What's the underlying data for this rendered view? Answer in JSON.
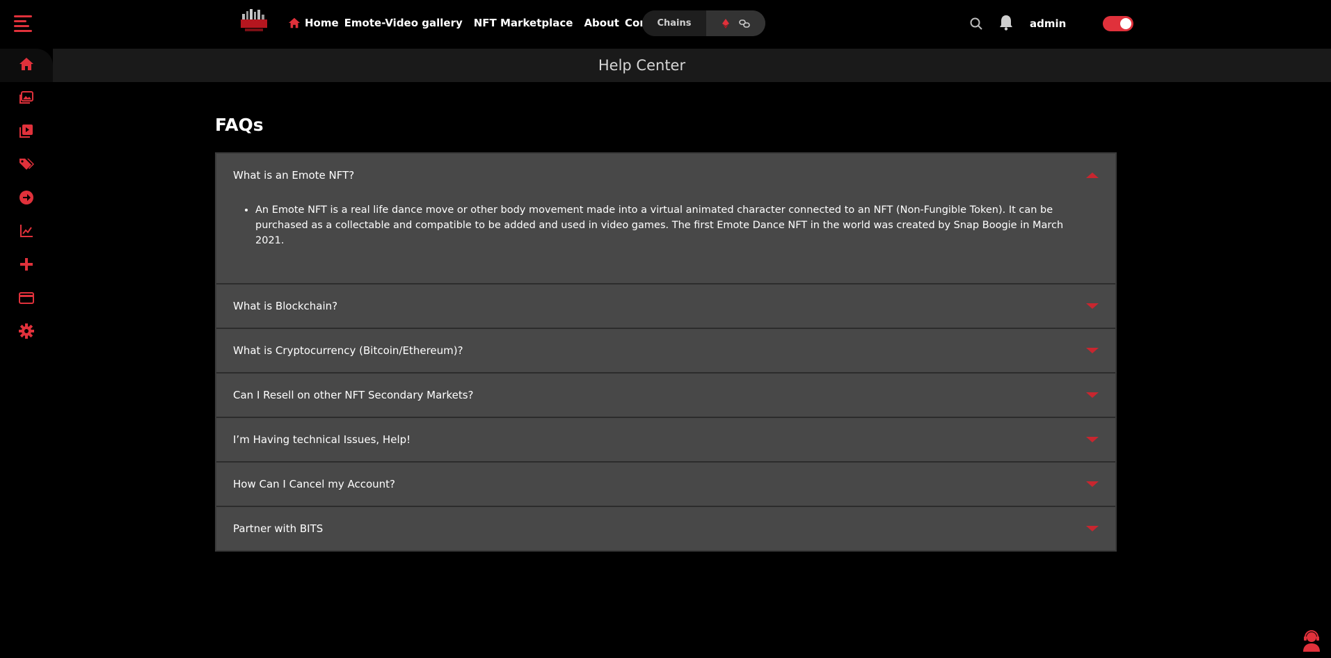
{
  "colors": {
    "accent": "#e0313b",
    "background": "#000000",
    "panel": "#484848"
  },
  "nav": {
    "items": [
      "Home",
      "Emote-Video gallery",
      "NFT Marketplace",
      "About",
      "Contact"
    ]
  },
  "chains": {
    "label": "Chains",
    "icons": [
      "ethereum-icon",
      "chain-link-icon"
    ]
  },
  "user": {
    "name": "admin"
  },
  "sidebar": {
    "icons": [
      "home-icon",
      "gallery-icon",
      "video-icon",
      "tags-icon",
      "arrow-circle-icon",
      "chart-icon",
      "plus-icon",
      "card-icon",
      "gear-icon"
    ]
  },
  "page": {
    "band_title": "Help Center",
    "faq_heading": "FAQs"
  },
  "faqs": [
    {
      "question": "What is an Emote NFT?",
      "expanded": true,
      "answer": "An Emote NFT is a real life dance move or other body movement made into a virtual animated character connected to an NFT (Non-Fungible Token). It can be purchased as a collectable and compatible to be added and used in video games. The first Emote Dance NFT in the world was created by Snap Boogie in March 2021."
    },
    {
      "question": "What is Blockchain?",
      "expanded": false
    },
    {
      "question": "What is Cryptocurrency (Bitcoin/Ethereum)?",
      "expanded": false
    },
    {
      "question": "Can I Resell on other NFT Secondary Markets?",
      "expanded": false
    },
    {
      "question": "I’m Having technical Issues, Help!",
      "expanded": false
    },
    {
      "question": "How Can I Cancel my Account?",
      "expanded": false
    },
    {
      "question": "Partner with BITS",
      "expanded": false
    }
  ]
}
